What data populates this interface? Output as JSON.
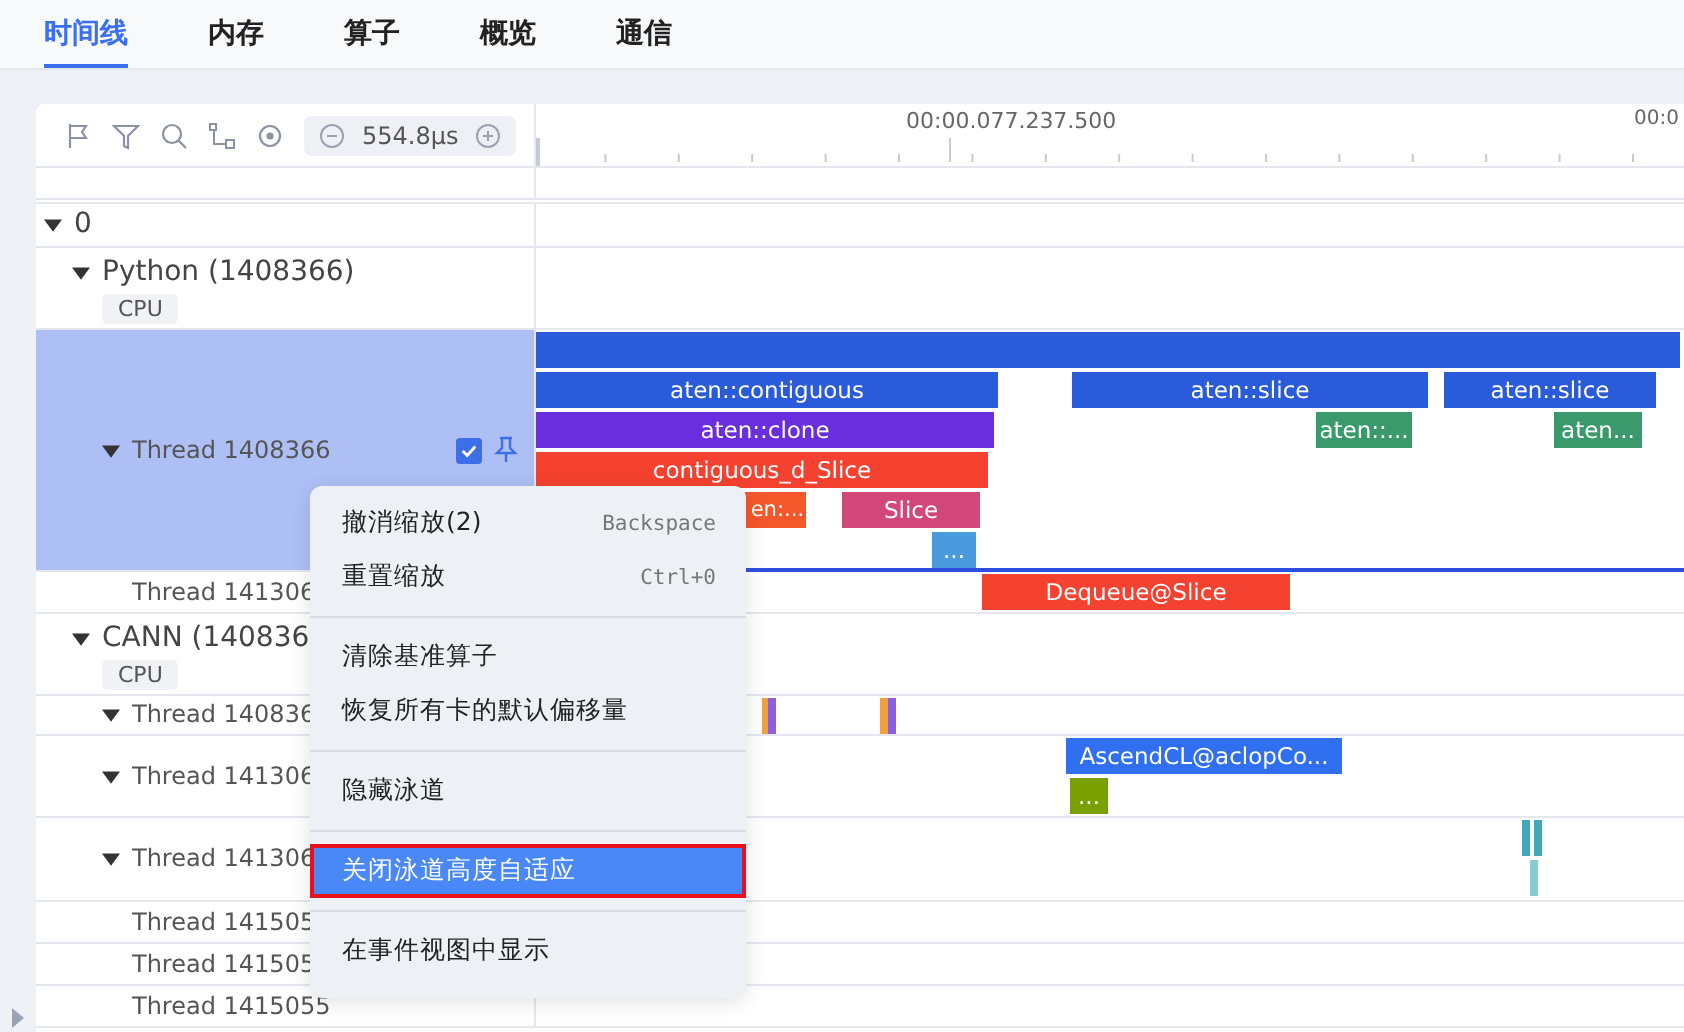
{
  "tabs": [
    {
      "label": "时间线",
      "selected": true
    },
    {
      "label": "内存",
      "selected": false
    },
    {
      "label": "算子",
      "selected": false
    },
    {
      "label": "概览",
      "selected": false
    },
    {
      "label": "通信",
      "selected": false
    }
  ],
  "toolbar": {
    "zoom": "554.8μs"
  },
  "ruler": {
    "labels": [
      "00:00.077.237.500",
      "00:0"
    ]
  },
  "lanes": [
    {
      "label": "0",
      "kind": "root",
      "expanded": true,
      "children": [
        {
          "label": "Python (1408366)",
          "kind": "process",
          "tag": "CPU",
          "expanded": true,
          "children": [
            {
              "label": "Thread 1408366",
              "kind": "thread",
              "expanded": true,
              "selected": true,
              "checked": true,
              "pinned": true,
              "events": [
                {
                  "color": "#2a5bdb"
                },
                {
                  "label": "aten::contiguous",
                  "color": "#2a5bdb"
                },
                {
                  "label": "aten::slice",
                  "color": "#2a5bdb"
                },
                {
                  "label": "aten::slice",
                  "color": "#2a5bdb"
                },
                {
                  "label": "aten::clone",
                  "color": "#6a2ede"
                },
                {
                  "label": "aten::...",
                  "color": "#3a9a6b"
                },
                {
                  "label": "aten...",
                  "color": "#3a9a6b"
                },
                {
                  "label": "contiguous_d_Slice",
                  "color": "#f5412f"
                },
                {
                  "label": "en:...",
                  "color": "#f4582a"
                },
                {
                  "label": "Slice",
                  "color": "#d1477a"
                },
                {
                  "label": "...",
                  "color": "#4a9ae0"
                }
              ]
            },
            {
              "label": "Thread 141306",
              "kind": "thread",
              "selected": false,
              "events": [
                {
                  "label": "Dequeue@Slice",
                  "color": "#f5412f"
                }
              ]
            }
          ]
        },
        {
          "label": "CANN (140836",
          "kind": "process",
          "tag": "CPU",
          "expanded": true,
          "children": [
            {
              "label": "Thread 140836",
              "kind": "thread",
              "expanded": true,
              "selected": false,
              "events": [
                {
                  "color": "#f0a040"
                },
                {
                  "color": "#8a60e0"
                },
                {
                  "color": "#f0a040"
                },
                {
                  "color": "#8a60e0"
                }
              ]
            },
            {
              "label": "Thread 141306",
              "kind": "thread",
              "expanded": true,
              "selected": false,
              "events": [
                {
                  "label": "AscendCL@aclopCo...",
                  "color": "#3070f0"
                },
                {
                  "label": "...",
                  "color": "#7aa000"
                }
              ]
            },
            {
              "label": "Thread 141306",
              "kind": "thread",
              "expanded": true,
              "selected": false,
              "events": [
                {
                  "color": "#40a8b8"
                },
                {
                  "color": "#40a8b8"
                },
                {
                  "color": "#88ccd4"
                }
              ]
            },
            {
              "label": "Thread 141505",
              "kind": "thread",
              "selected": false
            },
            {
              "label": "Thread 141505",
              "kind": "thread",
              "selected": false
            },
            {
              "label": "Thread 1415055",
              "kind": "thread",
              "selected": false
            }
          ]
        }
      ]
    }
  ],
  "context_menu": {
    "groups": [
      [
        {
          "label": "撤消缩放(2)",
          "shortcut": "Backspace",
          "selected": false
        },
        {
          "label": "重置缩放",
          "shortcut": "Ctrl+0",
          "selected": false
        }
      ],
      [
        {
          "label": "清除基准算子",
          "selected": false
        },
        {
          "label": "恢复所有卡的默认偏移量",
          "selected": false
        }
      ],
      [
        {
          "label": "隐藏泳道",
          "selected": false
        }
      ],
      [
        {
          "label": "关闭泳道高度自适应",
          "selected": true
        }
      ],
      [
        {
          "label": "在事件视图中显示",
          "selected": false
        }
      ]
    ]
  }
}
